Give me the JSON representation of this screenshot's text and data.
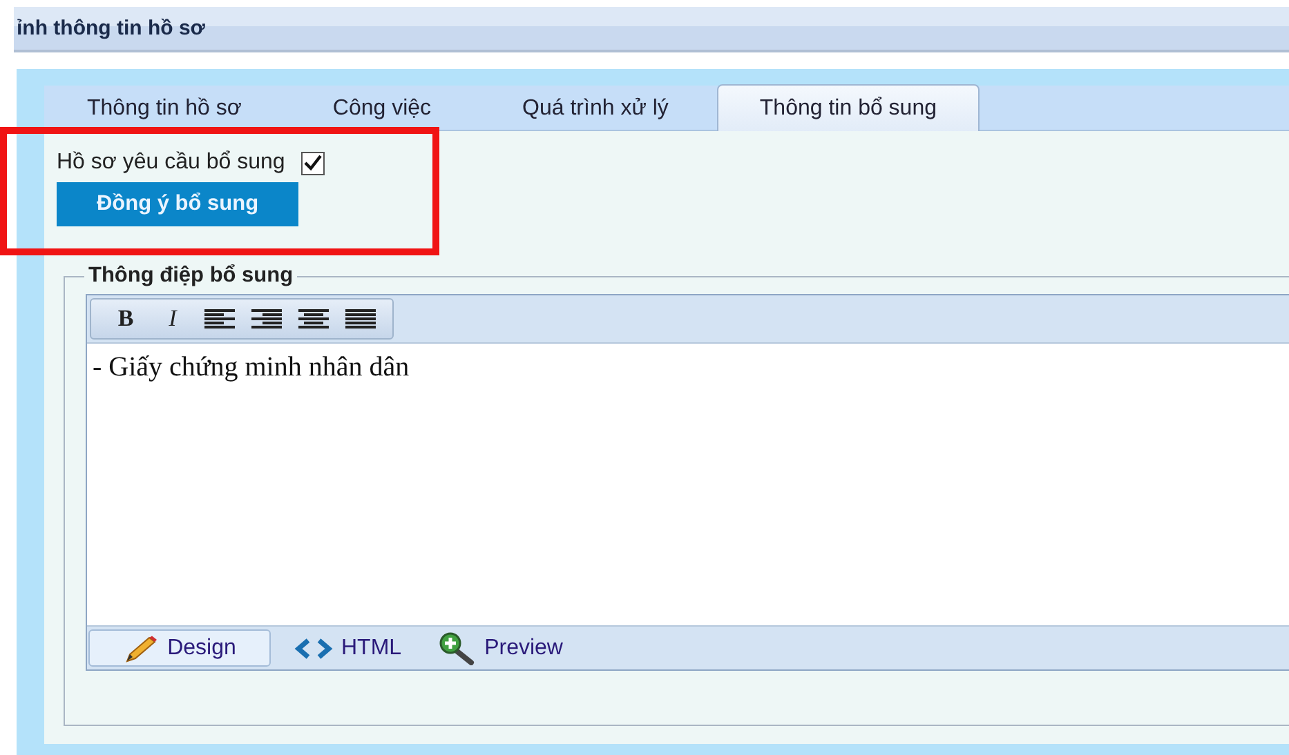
{
  "window": {
    "title": "ỉnh thông tin hồ sơ"
  },
  "tabs": [
    {
      "label": "Thông tin hồ sơ",
      "selected": false
    },
    {
      "label": "Công việc",
      "selected": false
    },
    {
      "label": "Quá trình xử lý",
      "selected": false
    },
    {
      "label": "Thông tin bổ sung",
      "selected": true
    }
  ],
  "request_checkbox": {
    "label": "Hồ sơ yêu cầu bổ sung",
    "checked": true
  },
  "approve_button": "Đồng ý bổ sung",
  "message_group": {
    "legend": "Thông điệp bổ sung",
    "toolbar": [
      {
        "kind": "bold",
        "label": "B"
      },
      {
        "kind": "italic",
        "label": "I"
      },
      {
        "kind": "align-left"
      },
      {
        "kind": "align-right"
      },
      {
        "kind": "align-center"
      },
      {
        "kind": "justify"
      }
    ],
    "content": "- Giấy chứng minh nhân dân",
    "modes": [
      {
        "kind": "design",
        "label": "Design",
        "selected": true
      },
      {
        "kind": "html",
        "label": "HTML",
        "selected": false
      },
      {
        "kind": "preview",
        "label": "Preview",
        "selected": false
      }
    ]
  }
}
